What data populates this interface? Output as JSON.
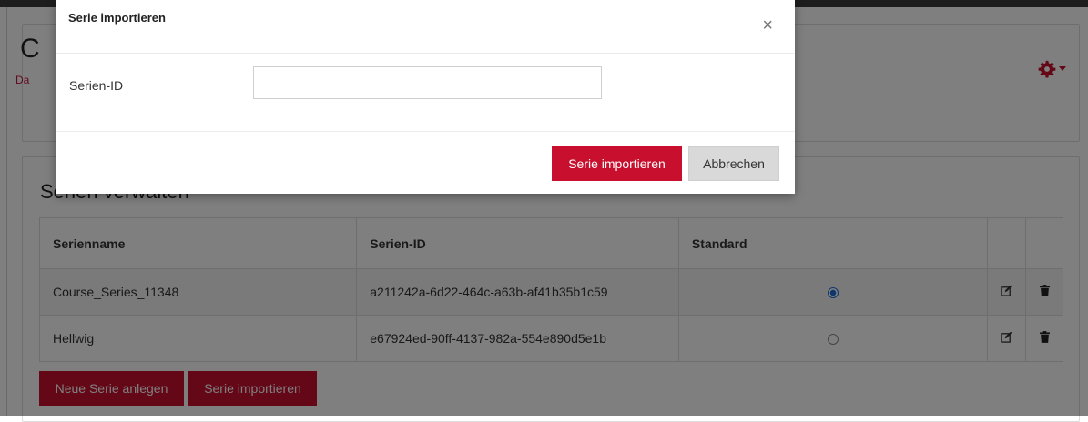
{
  "course": {
    "title": "C",
    "subtitle": "Da"
  },
  "section": {
    "title": "Serien verwalten"
  },
  "table": {
    "headers": [
      "Serienname",
      "Serien-ID",
      "Standard"
    ],
    "rows": [
      {
        "name": "Course_Series_11348",
        "id": "a211242a-6d22-464c-a63b-af41b35b1c59",
        "default": true
      },
      {
        "name": "Hellwig",
        "id": "e67924ed-90ff-4137-982a-554e890d5e1b",
        "default": false
      }
    ]
  },
  "buttons": {
    "new_series": "Neue Serie anlegen",
    "import_series": "Serie importieren"
  },
  "modal": {
    "title": "Serie importieren",
    "close": "×",
    "field_label": "Serien-ID",
    "field_value": "",
    "submit": "Serie importieren",
    "cancel": "Abbrechen"
  },
  "colors": {
    "primary": "#c8102e",
    "radio_checked": "#1e6fd9",
    "gear": "#c8102e"
  },
  "icons": {
    "gear": "gear-icon",
    "edit": "edit-icon",
    "delete": "trash-icon"
  }
}
